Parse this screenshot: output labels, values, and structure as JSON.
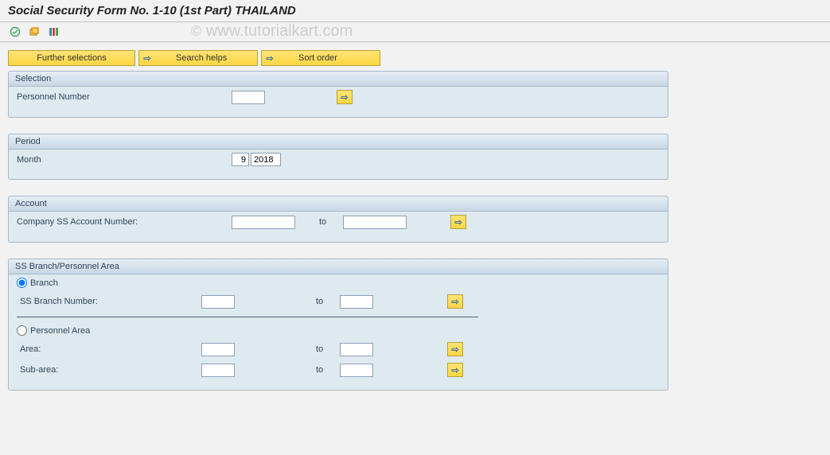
{
  "title": "Social Security Form No. 1-10 (1st Part)  THAILAND",
  "watermark": "www.tutorialkart.com",
  "buttons": {
    "further_selections": "Further selections",
    "search_helps": "Search helps",
    "sort_order": "Sort order"
  },
  "groups": {
    "selection": {
      "title": "Selection",
      "personnel_number_label": "Personnel Number",
      "personnel_number_value": ""
    },
    "period": {
      "title": "Period",
      "month_label": "Month",
      "month_value": "9",
      "year_value": "2018"
    },
    "account": {
      "title": "Account",
      "company_ss_label": "Company SS Account Number:",
      "to_label": "to",
      "from_value": "",
      "to_value": ""
    },
    "ss_branch": {
      "title": "SS Branch/Personnel Area",
      "branch_radio_label": "Branch",
      "ss_branch_number_label": "SS Branch Number:",
      "ss_branch_to_label": "to",
      "ss_branch_from": "",
      "ss_branch_to": "",
      "personnel_area_radio_label": "Personnel Area",
      "area_label": "Area:",
      "area_to_label": "to",
      "area_from": "",
      "area_to": "",
      "subarea_label": "Sub-area:",
      "subarea_to_label": "to",
      "subarea_from": "",
      "subarea_to": ""
    }
  }
}
